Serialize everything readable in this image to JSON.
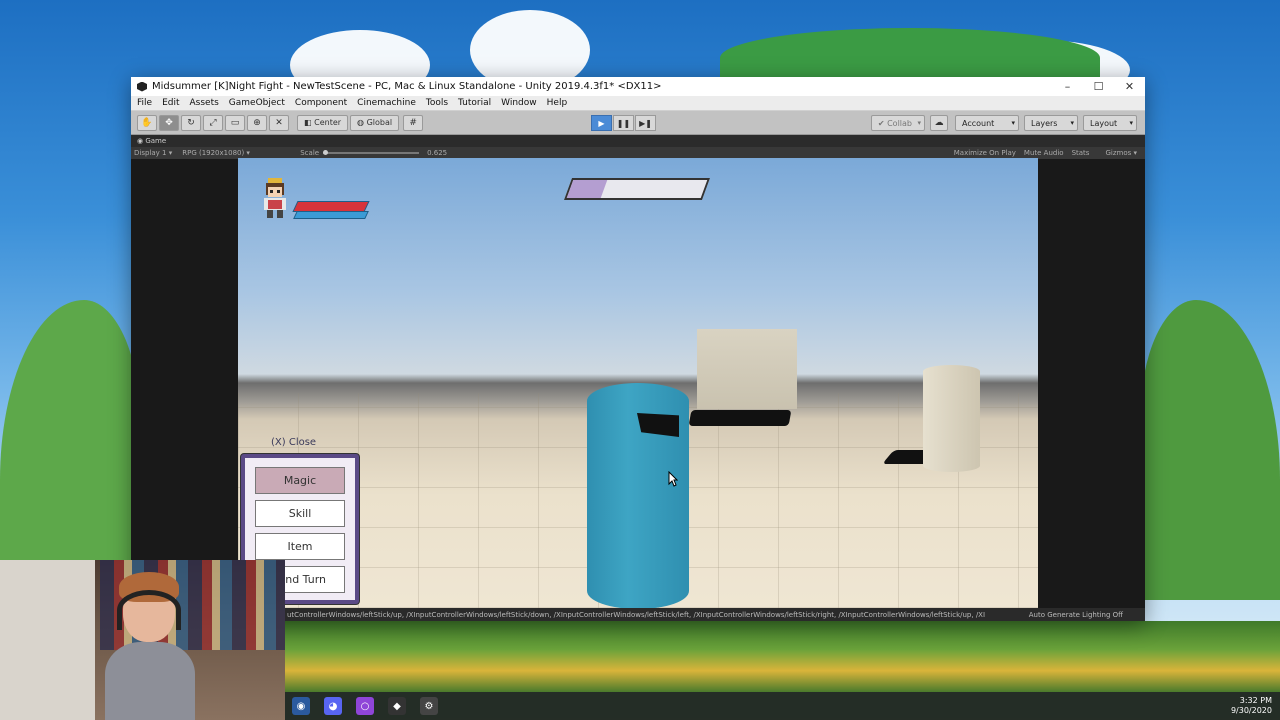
{
  "window": {
    "title": "Midsummer [K]Night Fight - NewTestScene - PC, Mac & Linux Standalone - Unity 2019.4.3f1* <DX11>",
    "controls": [
      "–",
      "☐",
      "✕"
    ]
  },
  "menu": [
    "File",
    "Edit",
    "Assets",
    "GameObject",
    "Component",
    "Cinemachine",
    "Tools",
    "Tutorial",
    "Window",
    "Help"
  ],
  "toolbar": {
    "pivot_label": "Center",
    "space_label": "Global",
    "collab_label": "Collab",
    "account_label": "Account",
    "layers_label": "Layers",
    "layout_label": "Layout"
  },
  "game_tab": {
    "label": "Game"
  },
  "game_bar": {
    "display": "Display 1",
    "resolution": "RPG (1920x1080)",
    "scale_label": "Scale",
    "scale_value": "0.625",
    "maximize": "Maximize On Play",
    "mute": "Mute Audio",
    "stats": "Stats",
    "gizmos": "Gizmos"
  },
  "game": {
    "close_label": "(X) Close",
    "commands": [
      "Magic",
      "Skill",
      "Item",
      "nd Turn"
    ],
    "turn_fill": 0.25
  },
  "status": {
    "text": "utControllerWindows/leftStick/up, /XInputControllerWindows/leftStick/down, /XInputControllerWindows/leftStick/left, /XInputControllerWindows/leftStick/right, /XInputControllerWindows/leftStick/up, /XI",
    "right": "Auto Generate Lighting Off"
  },
  "taskbar": {
    "time": "3:32 PM",
    "date": "9/30/2020"
  },
  "colors": {
    "accent": "#4b8bd6",
    "hp": "#d8333a",
    "mp": "#3b9bd6",
    "command_selected": "#c9aab6",
    "panel_border": "#5b4a86"
  }
}
